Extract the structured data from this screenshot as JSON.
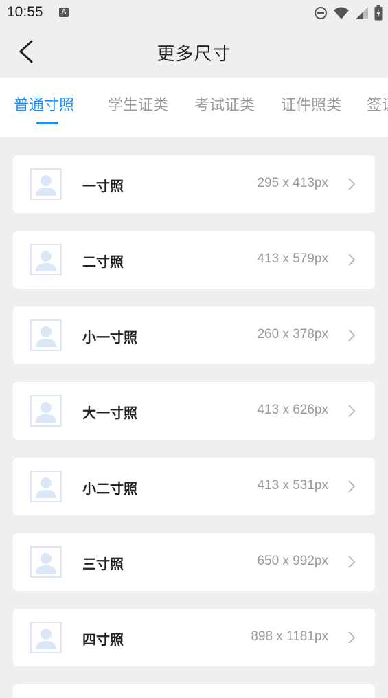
{
  "status": {
    "time": "10:55",
    "notification_badge": "A"
  },
  "header": {
    "title": "更多尺寸",
    "back_icon": "chevron-left-icon"
  },
  "tabs": [
    {
      "label": "普通寸照",
      "active": true
    },
    {
      "label": "学生证类",
      "active": false
    },
    {
      "label": "考试证类",
      "active": false
    },
    {
      "label": "证件照类",
      "active": false
    },
    {
      "label": "签证",
      "active": false
    }
  ],
  "sizes": [
    {
      "name": "一寸照",
      "dims": "295 x 413px"
    },
    {
      "name": "二寸照",
      "dims": "413 x 579px"
    },
    {
      "name": "小一寸照",
      "dims": "260 x 378px"
    },
    {
      "name": "大一寸照",
      "dims": "413 x 626px"
    },
    {
      "name": "小二寸照",
      "dims": "413 x 531px"
    },
    {
      "name": "三寸照",
      "dims": "650 x 992px"
    },
    {
      "name": "四寸照",
      "dims": "898 x 1181px"
    }
  ],
  "colors": {
    "accent": "#1f8ef1",
    "background": "#efefef",
    "muted_text": "#9a9a9a"
  }
}
